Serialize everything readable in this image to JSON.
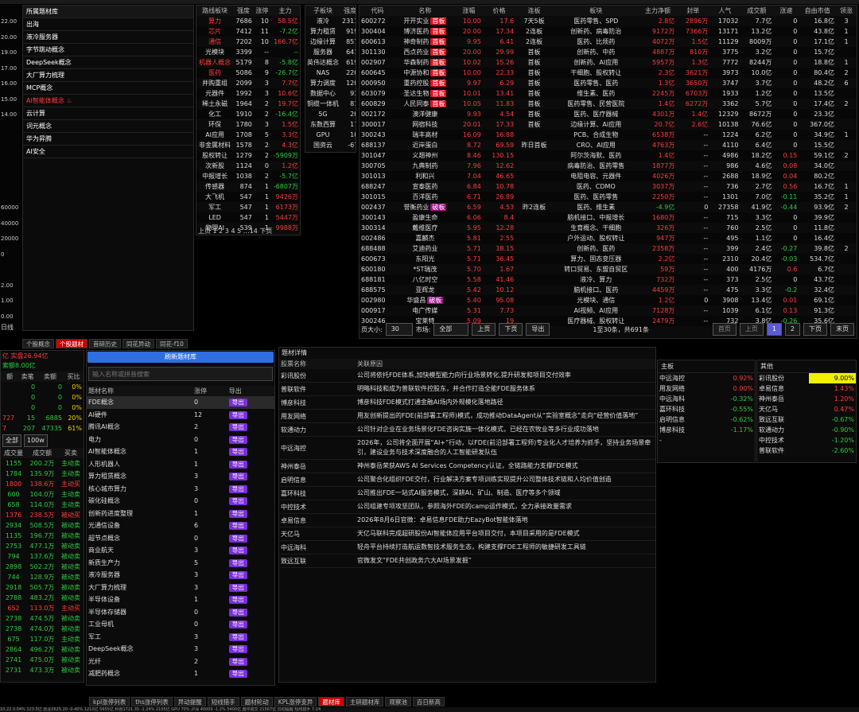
{
  "top_strip": [
    "",
    "",
    "",
    "",
    "",
    ""
  ],
  "left_axis": [
    "22.00",
    "20.00",
    "19.00",
    "17.00",
    "16.00",
    "15.00",
    "14.00",
    "",
    "",
    "",
    "",
    "",
    "60000",
    "40000",
    "20000",
    "0",
    "",
    "2.00",
    "1.00",
    "0.00"
  ],
  "left_axis_label": "日线",
  "hot_list": {
    "title": "所属题材库",
    "items": [
      "出海",
      "液冷服务器",
      "字节跳动概念",
      "DeepSeek概念",
      "大厂算力梳理",
      "MCP概念",
      "AI智能体概念",
      "云计算",
      "词元概念",
      "华为昇腾",
      "AI安全"
    ],
    "fire_index": 6
  },
  "sector": {
    "headers": [
      "路线板块",
      "强度",
      "涨停",
      "主力"
    ],
    "rows": [
      [
        "算力",
        "7686",
        "10",
        "58.5亿"
      ],
      [
        "芯片",
        "7412",
        "11",
        "-7.2亿"
      ],
      [
        "通信",
        "7202",
        "10",
        "166.7亿"
      ],
      [
        "光模块",
        "3399",
        "--",
        "--"
      ],
      [
        "机器人概念",
        "5179",
        "8",
        "-5.8亿"
      ],
      [
        "医药",
        "5086",
        "9",
        "-26.7亿"
      ],
      [
        "并购重组",
        "2099",
        "3",
        "7.7亿"
      ],
      [
        "元器件",
        "1992",
        "3",
        "10.6亿"
      ],
      [
        "稀土永磁",
        "1964",
        "2",
        "19.7亿"
      ],
      [
        "化工",
        "1910",
        "2",
        "-16.4亿"
      ],
      [
        "环保",
        "1780",
        "3",
        "1.5亿"
      ],
      [
        "AI应用",
        "1708",
        "5",
        "3.3亿"
      ],
      [
        "非金属材料",
        "1578",
        "2",
        "4.3亿"
      ],
      [
        "股权转让",
        "1279",
        "2",
        "-5909万"
      ],
      [
        "次新股",
        "1124",
        "0",
        "1.2亿"
      ],
      [
        "中报增长",
        "1038",
        "2",
        "-5.7亿"
      ],
      [
        "传感器",
        "874",
        "1",
        "-6807万"
      ],
      [
        "大飞机",
        "547",
        "1",
        "9426万"
      ],
      [
        "军工",
        "547",
        "1",
        "6173万"
      ],
      [
        "LED",
        "547",
        "1",
        "5447万"
      ],
      [
        "物理AI",
        "539",
        "1",
        "9988万"
      ]
    ],
    "name_colors": [
      "r",
      "r",
      "r",
      "w",
      "r",
      "r",
      "w",
      "w",
      "w",
      "w",
      "w",
      "w",
      "w",
      "w",
      "w",
      "w",
      "w",
      "w",
      "w",
      "w",
      "w"
    ],
    "pager": "上页  1  2  3  4  5  …14  下页"
  },
  "sub": {
    "headers": [
      "子板块",
      "强度"
    ],
    "rows": [
      [
        "液冷",
        "2311"
      ],
      [
        "算力租赁",
        "919"
      ],
      [
        "边缘计算",
        "857"
      ],
      [
        "服务器",
        "641"
      ],
      [
        "英伟达概念",
        "619"
      ],
      [
        "NAS",
        "220"
      ],
      [
        "算力调度",
        "120"
      ],
      [
        "数据中心",
        "93"
      ],
      [
        "铜缆一体机",
        "81"
      ],
      [
        "5G",
        "20"
      ],
      [
        "东数西算",
        "17"
      ],
      [
        "GPU",
        "10"
      ],
      [
        "国资云",
        "-67"
      ]
    ]
  },
  "stocks": {
    "headers": [
      "代码",
      "名称",
      "涨幅",
      "价格",
      "连板",
      "板块",
      "主力净额",
      "封单",
      "人气",
      "成交额",
      "涨速",
      "自由市值",
      "领涨"
    ],
    "rows": [
      [
        "600272",
        "开开实业",
        "首板",
        "10.00",
        "17.6",
        "7天5板",
        "医药零售、SPD",
        "2.8亿",
        "2896万",
        "17032",
        "7.7亿",
        "0",
        "16.8亿",
        "3"
      ],
      [
        "300404",
        "博济医药",
        "首板",
        "20.00",
        "17.34",
        "2连板",
        "创新药、病毒防治",
        "9172万",
        "7366万",
        "13171",
        "13.2亿",
        "0",
        "43.8亿",
        "1"
      ],
      [
        "600613",
        "神奇制药",
        "首板",
        "9.95",
        "6.41",
        "2连板",
        "医药、比烦药",
        "4072万",
        "1.5亿",
        "11129",
        "8009万",
        "0",
        "17.1亿",
        "1"
      ],
      [
        "301130",
        "西点药业",
        "首板",
        "20.00",
        "29.99",
        "首板",
        "创新药、中药",
        "4887万",
        "810万",
        "3775",
        "3.2亿",
        "0",
        "15.7亿",
        ""
      ],
      [
        "002907",
        "华森制药",
        "首板",
        "10.02",
        "15.26",
        "首板",
        "创新药、AI应用",
        "5957万",
        "1.3亿",
        "7772",
        "8244万",
        "0",
        "18.8亿",
        "1"
      ],
      [
        "600645",
        "中源协和",
        "首板",
        "10.00",
        "22.33",
        "首板",
        "干细胞、股权转让",
        "2.3亿",
        "3621万",
        "3973",
        "10.0亿",
        "0",
        "80.4亿",
        "2"
      ],
      [
        "000950",
        "重药控股",
        "首板",
        "9.97",
        "6.29",
        "首板",
        "医药零售、医药",
        "1.3亿",
        "3650万",
        "3747",
        "3.7亿",
        "0",
        "48.2亿",
        "6"
      ],
      [
        "603079",
        "圣达生物",
        "首板",
        "10.01",
        "13.41",
        "首板",
        "维生素、医药",
        "2245万",
        "6703万",
        "1933",
        "1.2亿",
        "0",
        "13.5亿",
        ""
      ],
      [
        "600829",
        "人民同泰",
        "首板",
        "10.05",
        "11.83",
        "首板",
        "医药零售、民营医院",
        "1.4亿",
        "6272万",
        "3362",
        "5.7亿",
        "0",
        "17.4亿",
        "2"
      ],
      [
        "002172",
        "澳洋健康",
        "",
        "9.93",
        "4.54",
        "首板",
        "医药、医疗器械",
        "4301万",
        "1.4亿",
        "12329",
        "8672万",
        "0",
        "23.3亿",
        ""
      ],
      [
        "300017",
        "网宿科技",
        "",
        "20.01",
        "17.33",
        "首板",
        "边缘计算、AI应用",
        "20.7亿",
        "2.6亿",
        "10138",
        "76.6亿",
        "0",
        "367.0亿",
        ""
      ],
      [
        "300243",
        "瑞丰高材",
        "",
        "16.09",
        "16.88",
        "",
        "PCB、合成生物",
        "6538万",
        "--",
        "1224",
        "6.2亿",
        "0",
        "34.9亿",
        "1"
      ],
      [
        "688137",
        "近岸蛋白",
        "",
        "8.72",
        "69.59",
        "昨日首板",
        "CRO、AI应用",
        "4763万",
        "--",
        "4110",
        "6.4亿",
        "0",
        "15.5亿",
        ""
      ],
      [
        "301047",
        "义翘神州",
        "",
        "8.46",
        "130.15",
        "",
        "阿尔茨海默、医药",
        "1.4亿",
        "--",
        "4986",
        "18.2亿",
        "0.15",
        "59.1亿",
        "2"
      ],
      [
        "300705",
        "九典制药",
        "",
        "7.96",
        "12.62",
        "",
        "病毒防治、医药零售",
        "1877万",
        "--",
        "986",
        "4.6亿",
        "0.08",
        "34.0亿",
        ""
      ],
      [
        "301013",
        "利和兴",
        "",
        "7.04",
        "46.65",
        "",
        "电阻电容、元器件",
        "4026万",
        "--",
        "2688",
        "18.9亿",
        "0.04",
        "80.2亿",
        ""
      ],
      [
        "688247",
        "宣泰医药",
        "",
        "6.84",
        "10.78",
        "",
        "医药、CDMO",
        "3037万",
        "--",
        "736",
        "2.7亿",
        "0.56",
        "16.7亿",
        "1"
      ],
      [
        "301015",
        "百洋医药",
        "",
        "6.71",
        "26.89",
        "",
        "医药、医药零售",
        "2250万",
        "--",
        "1301",
        "7.0亿",
        "-0.11",
        "35.2亿",
        "1"
      ],
      [
        "002437",
        "誉衡药业",
        "破板",
        "6.59",
        "4.53",
        "昨2连板",
        "医药、维生素",
        "-4.9亿",
        "0",
        "27358",
        "41.9亿",
        "-0.44",
        "93.9亿",
        "2"
      ],
      [
        "300143",
        "盈康生命",
        "",
        "6.06",
        "8.4",
        "",
        "脑机接口、中报增长",
        "1680万",
        "--",
        "715",
        "3.3亿",
        "0",
        "39.9亿",
        ""
      ],
      [
        "300314",
        "戴维医疗",
        "",
        "5.95",
        "12.28",
        "",
        "生育概念、干细胞",
        "326万",
        "--",
        "760",
        "2.5亿",
        "0",
        "11.8亿",
        ""
      ],
      [
        "002486",
        "嘉麟杰",
        "",
        "5.81",
        "2.55",
        "",
        "户外运动、股权转让",
        "947万",
        "--",
        "495",
        "1.1亿",
        "0",
        "16.4亿",
        ""
      ],
      [
        "688488",
        "艾迪药业",
        "",
        "5.71",
        "18.15",
        "",
        "创新药、医药",
        "2358万",
        "--",
        "399",
        "2.4亿",
        "-0.27",
        "39.8亿",
        "2"
      ],
      [
        "600673",
        "东阳光",
        "",
        "5.71",
        "36.45",
        "",
        "算力、固态变压器",
        "2.2亿",
        "--",
        "2310",
        "20.4亿",
        "-0.03",
        "534.7亿",
        ""
      ],
      [
        "600180",
        "*ST瑞茂",
        "",
        "5.70",
        "1.67",
        "",
        "转口贸易、东盟自贸区",
        "59万",
        "--",
        "400",
        "4176万",
        "0.6",
        "6.7亿",
        ""
      ],
      [
        "688181",
        "八亿时空",
        "",
        "5.58",
        "41.46",
        "",
        "液冷、算力",
        "732万",
        "--",
        "373",
        "2.5亿",
        "0",
        "43.7亿",
        ""
      ],
      [
        "688575",
        "亚辉龙",
        "",
        "5.42",
        "10.12",
        "",
        "脑机接口、医药",
        "4459万",
        "--",
        "475",
        "3.3亿",
        "-0.2",
        "32.4亿",
        ""
      ],
      [
        "002980",
        "华盛昌",
        "破板",
        "5.40",
        "95.08",
        "",
        "光模块、通信",
        "1.2亿",
        "0",
        "3908",
        "13.4亿",
        "0.01",
        "69.1亿",
        ""
      ],
      [
        "000917",
        "电广传媒",
        "",
        "5.31",
        "7.73",
        "",
        "AI视频、AI应用",
        "7128万",
        "--",
        "1039",
        "6.1亿",
        "0.13",
        "91.3亿",
        ""
      ],
      [
        "300246",
        "宝莱特",
        "",
        "5.09",
        "19",
        "",
        "医疗器械、股权转让",
        "2479万",
        "--",
        "732",
        "3.8亿",
        "-0.26",
        "35.6亿",
        ""
      ]
    ],
    "footer": {
      "pagesize_label": "页大小:",
      "pagesize": "30",
      "market_label": "市场:",
      "market": "全部",
      "prev": "上页",
      "next": "下页",
      "export": "导出",
      "summary": "1至30条，共691条",
      "first": "首页",
      "prev2": "上页",
      "p1": "1",
      "p2": "2",
      "next2": "下页",
      "last": "末页"
    }
  },
  "left_tabs": [
    "个股概念",
    "个股题材",
    "首研历史",
    "同花异动",
    "同花-f10"
  ],
  "fund": {
    "line1a": "亿",
    "line1b": "实盘26.94亿",
    "line2": "索额8.00亿",
    "headers": [
      "额",
      "卖笔",
      "卖额",
      "买比"
    ],
    "rows": [
      [
        "",
        "0",
        "0",
        "0%"
      ],
      [
        "",
        "0",
        "0",
        "0%"
      ],
      [
        "",
        "0",
        "0",
        "0%"
      ],
      [
        "727",
        "15",
        "6885",
        "20%"
      ],
      [
        "7",
        "207",
        "47335",
        "61%"
      ]
    ],
    "filter_all": "全部",
    "filter_amt": "100w",
    "headers2": [
      "成交量",
      "成交额",
      "买卖"
    ],
    "rows2": [
      [
        "1155",
        "200.2万",
        "主动卖"
      ],
      [
        "1784",
        "135.9万",
        "主动卖"
      ],
      [
        "1800",
        "138.6万",
        "主动买"
      ],
      [
        "600",
        "104.0万",
        "主动卖"
      ],
      [
        "658",
        "114.0万",
        "主动卖"
      ],
      [
        "1376",
        "238.5万",
        "被动买"
      ],
      [
        "2934",
        "508.5万",
        "被动卖"
      ],
      [
        "1135",
        "196.7万",
        "被动卖"
      ],
      [
        "2753",
        "477.1万",
        "被动卖"
      ],
      [
        "794",
        "137.6万",
        "被动卖"
      ],
      [
        "2898",
        "502.2万",
        "被动卖"
      ],
      [
        "744",
        "128.9万",
        "被动卖"
      ],
      [
        "2918",
        "505.7万",
        "被动卖"
      ],
      [
        "2788",
        "483.2万",
        "被动卖"
      ],
      [
        "652",
        "113.0万",
        "主动买"
      ],
      [
        "2738",
        "474.5万",
        "被动卖"
      ],
      [
        "2738",
        "474.0万",
        "被动卖"
      ],
      [
        "675",
        "117.0万",
        "主动卖"
      ],
      [
        "2864",
        "496.2万",
        "被动卖"
      ],
      [
        "2741",
        "475.0万",
        "被动卖"
      ],
      [
        "2731",
        "473.3万",
        "被动卖"
      ]
    ]
  },
  "theme": {
    "refresh": "刷新题材库",
    "search_placeholder": "输入名称或拼音搜索",
    "headers": [
      "题材名称",
      "涨停",
      "导出"
    ],
    "export_label": "导出",
    "rows": [
      [
        "FDE概念",
        "0"
      ],
      [
        "AI硬件",
        "12"
      ],
      [
        "腾讯AI概念",
        "2"
      ],
      [
        "电力",
        "0"
      ],
      [
        "AI智能体概念",
        "1"
      ],
      [
        "人形机器人",
        "1"
      ],
      [
        "算力租赁概念",
        "3"
      ],
      [
        "核心城市算力",
        "3"
      ],
      [
        "碳化硅概念",
        "0"
      ],
      [
        "创新药进度整理",
        "1"
      ],
      [
        "光通信设备",
        "6"
      ],
      [
        "超节点概念",
        "0"
      ],
      [
        "商业航天",
        "3"
      ],
      [
        "新质生产力",
        "5"
      ],
      [
        "液冷服务器",
        "3"
      ],
      [
        "大厂算力梳理",
        "3"
      ],
      [
        "半导体设备",
        "1"
      ],
      [
        "半导体存储器",
        "0"
      ],
      [
        "工业母机",
        "0"
      ],
      [
        "军工",
        "3"
      ],
      [
        "DeepSeek概念",
        "3"
      ],
      [
        "光纤",
        "2"
      ],
      [
        "减肥药概念",
        "1"
      ]
    ]
  },
  "detail": {
    "title": "题材详情",
    "headers": [
      "股票名称",
      "关联原因"
    ],
    "rows": [
      [
        "彩讯股份",
        "公司将依托FDE体系,加快模型能力向行业场景转化,提升研发和项目交付效率"
      ],
      [
        "普联软件",
        "明略科技和成为普联软件控股东，并合作打造全能FDE服务体系"
      ],
      [
        "博彦科技",
        "博彦科技FDE模式打通金融AI场内外规模化落地路径"
      ],
      [
        "用友网络",
        "用友创新提出的FDE(前部署工程师)模式，成功推动DataAgent从“实验室概念”走向“经营价值落地”"
      ],
      [
        "软通动力",
        "公司针对企业在业务场景化FDE咨询实施一体化模式，已经在农牧业等多行业成功落地"
      ],
      [
        "中远海控",
        "2026年，公司将全面开展“AI+”行动，以FDE(前沿部署工程师)专业化人才培养为抓手，坚持业务场景牵引，建设业务与技术深度融合的人工智能研发队伍"
      ],
      [
        "神州泰岳",
        "神州泰岳荣获AWS AI Services Competency认证，全链路能力支撑FDE模式"
      ],
      [
        "启明信息",
        "公司聚合化组织FDE交付，行业解决方案专项训练实现提升公司整体技术链和人均价值创造"
      ],
      [
        "嘉环科技",
        "公司推出FDE一站式AI服务模式，深耕AI、矿山、制造、医疗等多个领域"
      ],
      [
        "中控技术",
        "公司组建专项攻坚团队，参照海外FDE的camp运作模式，全力承接政量需求"
      ],
      [
        "卓易信息",
        "2026年8月6日官微：卓易信息FDE助力EazyBot智能体落地"
      ],
      [
        "天亿马",
        "天亿马联科完成超研股份AI智能体应用平台项目交付，本项目采用的是FDE模式"
      ],
      [
        "中远海科",
        "轻舟平台持续打造航运数智技术服务生态，构建支撑FDE工程师的敏捷研发工具链"
      ],
      [
        "致远互联",
        "官微发文“FDE共创政务六大AI场景发掘”"
      ]
    ]
  },
  "mainboard": {
    "title": "主板",
    "rows": [
      [
        "中远海控",
        "0.92%"
      ],
      [
        "用友网络",
        "0.00%"
      ],
      [
        "中远海科",
        "-0.32%"
      ],
      [
        "嘉环科技",
        "-0.55%"
      ],
      [
        "启明信息",
        "-0.62%"
      ],
      [
        "博彦科技",
        "-1.17%"
      ],
      [
        "-",
        ""
      ]
    ]
  },
  "other": {
    "title": "其他",
    "rows": [
      [
        "彩讯股份",
        "9.00%"
      ],
      [
        "卓易信息",
        "1.43%"
      ],
      [
        "神州泰岳",
        "1.20%"
      ],
      [
        "天亿马",
        "0.47%"
      ],
      [
        "致远互联",
        "-0.67%"
      ],
      [
        "软通动力",
        "-0.90%"
      ],
      [
        "中控技术",
        "-1.20%"
      ],
      [
        "普联软件",
        "-2.60%"
      ]
    ]
  },
  "bottom_tabs": [
    "kpl涨停列表",
    "ths涨停列表",
    "异动提醒",
    "短线猎手",
    "题材轮动",
    "KPL涨停变异",
    "题材库",
    "主研题材库",
    "观察池",
    "百日新高"
  ],
  "bottom_active": 6,
  "status": "10.22  0.04%  123.5亿    创业2625.20  -0.40%  1210亿    5655亿  科创1721.35  -1.24%  2105亿   GPU 70%   沪深  40000  -1.2%    5400亿  盘中成交  21567亿  异动提醒  短线猎手    7:24"
}
